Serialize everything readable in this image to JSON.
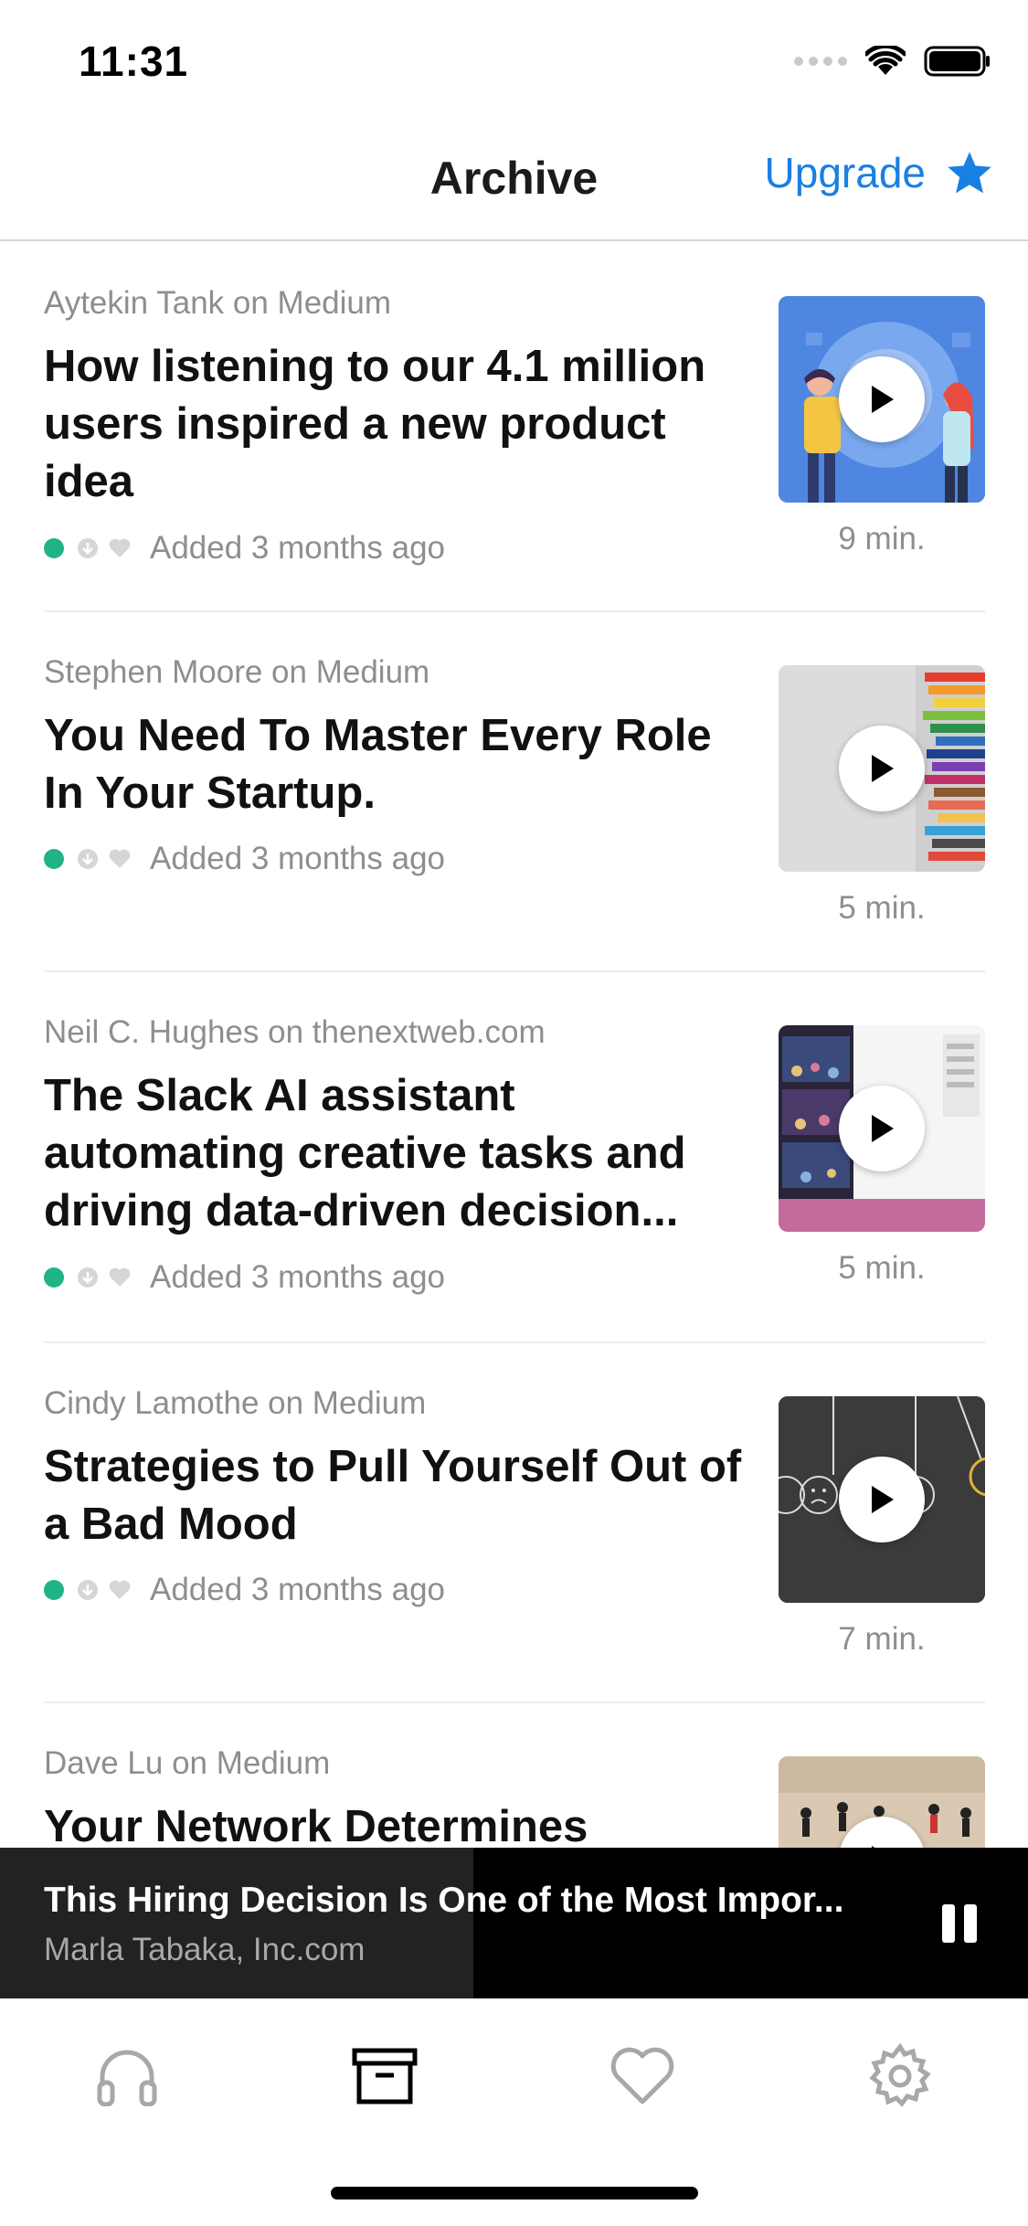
{
  "status_bar": {
    "time": "11:31"
  },
  "nav": {
    "title": "Archive",
    "upgrade_label": "Upgrade"
  },
  "articles": [
    {
      "source": "Aytekin Tank on Medium",
      "title": "How listening to our 4.1 million users inspired a new product idea",
      "added": "Added 3 months ago",
      "duration": "9 min.",
      "thumbnail": "people-illustration"
    },
    {
      "source": "Stephen Moore on Medium",
      "title": "You Need To Master Every Role In Your Startup.",
      "added": "Added 3 months ago",
      "duration": "5 min.",
      "thumbnail": "colored-pencils"
    },
    {
      "source": "Neil C. Hughes on thenextweb.com",
      "title": "The Slack AI assistant automating creative tasks and driving data-driven decision...",
      "added": "Added 3 months ago",
      "duration": "5 min.",
      "thumbnail": "slack-screenshot"
    },
    {
      "source": "Cindy Lamothe on Medium",
      "title": "Strategies to Pull Yourself Out of a Bad Mood",
      "added": "Added 3 months ago",
      "duration": "7 min.",
      "thumbnail": "hanging-faces"
    },
    {
      "source": "Dave Lu on Medium",
      "title": "Your Network Determines",
      "thumbnail": "desert-people"
    }
  ],
  "now_playing": {
    "title": "This Hiring Decision Is One of the Most Impor...",
    "subtitle": "Marla Tabaka, Inc.com",
    "progress": 0.46
  },
  "tabs": [
    {
      "icon": "headphones-icon"
    },
    {
      "icon": "archive-icon",
      "active": true
    },
    {
      "icon": "heart-icon"
    },
    {
      "icon": "gear-icon"
    }
  ],
  "colors": {
    "accent": "#1a7fe3",
    "status_green": "#21b386",
    "secondary_text": "#8e8e8e",
    "now_playing_bg": "#000000"
  }
}
